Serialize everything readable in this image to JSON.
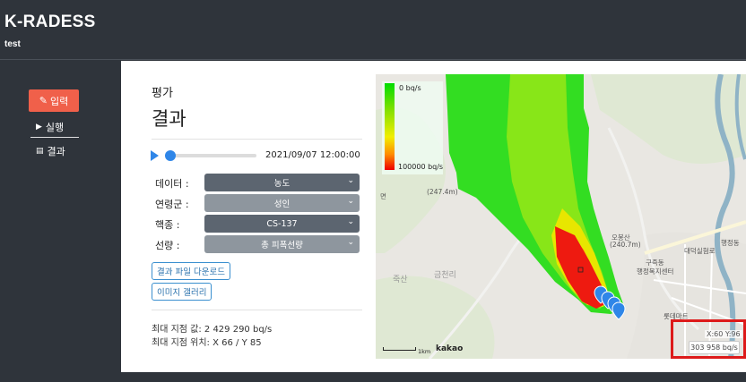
{
  "app": {
    "title": "K-RADESS",
    "subtitle": "test"
  },
  "sidebar": {
    "items": [
      {
        "label": "입력",
        "icon": "edit-icon",
        "active": true
      },
      {
        "label": "실행",
        "icon": "play-icon",
        "active": false
      },
      {
        "label": "결과",
        "icon": "file-icon",
        "active": false
      }
    ]
  },
  "main": {
    "section_title": "평가",
    "section_subtitle": "결과",
    "timestamp": "2021/09/07 12:00:00",
    "playback_position": 0.0,
    "form": [
      {
        "label": "데이터 :",
        "value": "농도"
      },
      {
        "label": "연령군 :",
        "value": "성인"
      },
      {
        "label": "핵종 :",
        "value": "CS-137"
      },
      {
        "label": "선량 :",
        "value": "총 피폭선량"
      }
    ],
    "buttons": {
      "download": "결과 파일 다운로드",
      "gallery": "이미지 갤러리"
    },
    "stats": {
      "max_value": "최대 지점 값: 2 429 290 bq/s",
      "max_position": "최대 지점 위치: X 66 / Y 85"
    }
  },
  "map": {
    "legend": {
      "max_label": "0 bq/s",
      "min_label": "100000 bq/s"
    },
    "place_labels": [
      "(247.4m)",
      "오봉산",
      "(240.7m)",
      "구즉동",
      "행정복지센터",
      "대덕실험로",
      "행정동",
      "롯데마트",
      "금천리",
      "죽산",
      "면"
    ],
    "scale": "1km",
    "logo": "kakao",
    "readout": {
      "coord": "X:60 Y:96",
      "value": "303 958 bq/s"
    },
    "colors": {
      "low": "#00dd00",
      "mid": "#f2ee00",
      "high": "#ee0000",
      "marker": "#2f86e8",
      "highlight": "#dd1a1a"
    }
  }
}
